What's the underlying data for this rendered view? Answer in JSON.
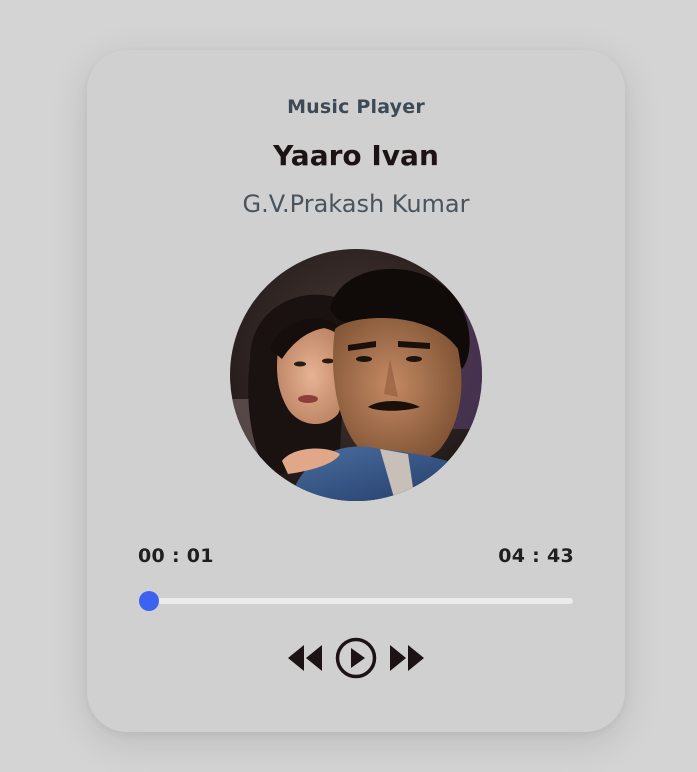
{
  "player": {
    "header": "Music Player",
    "song_title": "Yaaro Ivan",
    "artist": "G.V.Prakash Kumar",
    "current_time": "00 : 01",
    "total_time": "04 : 43",
    "progress_fraction": 0.0035,
    "accent_color": "#3b63f0"
  },
  "controls": {
    "previous_icon": "rewind-icon",
    "play_icon": "play-circle-icon",
    "next_icon": "fast-forward-icon"
  }
}
